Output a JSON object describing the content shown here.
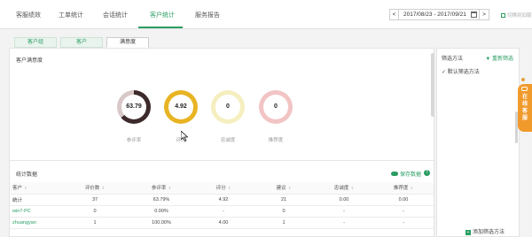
{
  "nav": {
    "tabs": [
      {
        "label": "客服绩效"
      },
      {
        "label": "工单统计"
      },
      {
        "label": "会话统计"
      },
      {
        "label": "客户统计"
      },
      {
        "label": "服务报告"
      }
    ],
    "active_tab": "客户统计",
    "prev_label": "<",
    "date_range": "2017/08/23 - 2017/09/21",
    "next_label": ">",
    "switch_label": "切换到旧版",
    "accent_color": "#2a9d63"
  },
  "subtabs": [
    {
      "label": "客户组"
    },
    {
      "label": "客户"
    },
    {
      "label": "满意度"
    }
  ],
  "satisfaction": {
    "title": "客户满意度",
    "metrics": [
      {
        "value": "63.79",
        "label": "参评率",
        "fraction": 0.6379,
        "color": "#3d2a2a",
        "track": "#d8c8c8"
      },
      {
        "value": "4.92",
        "label": "评分",
        "fraction": 1.0,
        "color": "#e8b424",
        "track": "#f5e3a5"
      },
      {
        "value": "0",
        "label": "忠诚度",
        "fraction": 0.0,
        "color": "#e8e0a0",
        "track": "#f5efc0"
      },
      {
        "value": "0",
        "label": "推荐度",
        "fraction": 0.0,
        "color": "#e9a5a5",
        "track": "#f2c4c4"
      }
    ]
  },
  "stats": {
    "title": "统计数据",
    "save_label": "保存数据",
    "help_label": "?",
    "columns": [
      "客户",
      "评价数",
      "参评率",
      "评分",
      "建议",
      "忠诚度",
      "推荐度"
    ],
    "rows": [
      [
        "统计",
        "37",
        "63.79%",
        "4.92",
        "21",
        "0.00",
        "0.00"
      ],
      [
        "win7-PC",
        "0",
        "0.00%",
        "-",
        "0",
        "-",
        "-"
      ],
      [
        "zhuangyan",
        "1",
        "100.00%",
        "4.00",
        "1",
        "-",
        "-"
      ]
    ]
  },
  "filter": {
    "title": "筛选方法",
    "reset_label": "重新筛选",
    "default_label": "默认筛选方法",
    "add_label": "添加筛选方法"
  },
  "online": {
    "label": "在线客服"
  }
}
